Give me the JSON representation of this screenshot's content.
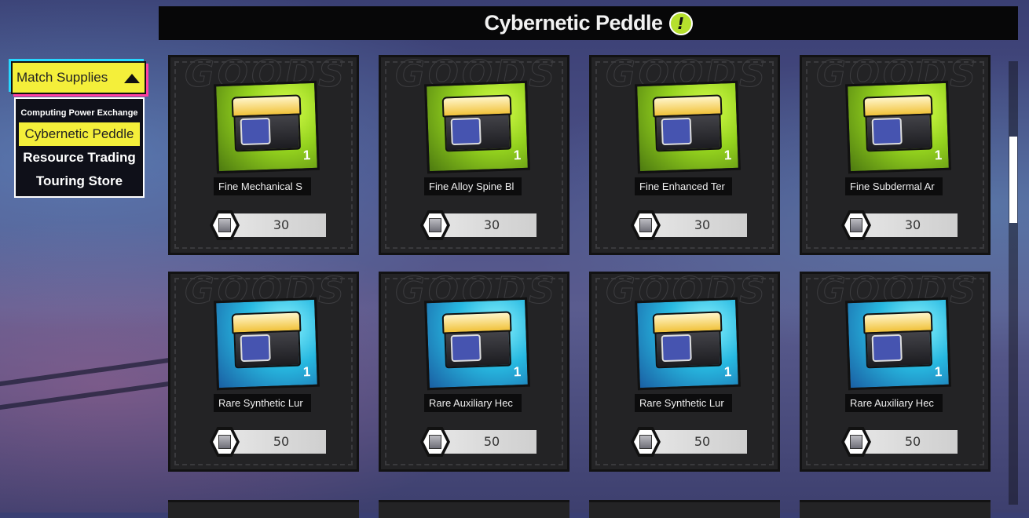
{
  "header": {
    "title": "Cybernetic Peddle",
    "icon": "exclamation-badge-icon",
    "accent": "#b5e02d"
  },
  "menu": {
    "header_label": "Match Supplies",
    "items": [
      {
        "label": "Computing Power Exchange",
        "active": false
      },
      {
        "label": "Cybernetic Peddle",
        "active": true
      },
      {
        "label": "Resource Trading",
        "active": false
      },
      {
        "label": "Touring Store",
        "active": false
      }
    ],
    "accent": "#f4ef3a"
  },
  "goods_watermark": "GOODS",
  "cards": [
    {
      "name": "Fine Mechanical S",
      "quantity": "1",
      "price": "30",
      "rarity_color": "#94d21e"
    },
    {
      "name": "Fine Alloy Spine Bl",
      "quantity": "1",
      "price": "30",
      "rarity_color": "#94d21e"
    },
    {
      "name": "Fine Enhanced Ter",
      "quantity": "1",
      "price": "30",
      "rarity_color": "#94d21e"
    },
    {
      "name": "Fine Subdermal Ar",
      "quantity": "1",
      "price": "30",
      "rarity_color": "#94d21e"
    },
    {
      "name": "Rare Synthetic Lur",
      "quantity": "1",
      "price": "50",
      "rarity_color": "#27b8e0"
    },
    {
      "name": "Rare Auxiliary Hec",
      "quantity": "1",
      "price": "50",
      "rarity_color": "#27b8e0"
    },
    {
      "name": "Rare Synthetic Lur",
      "quantity": "1",
      "price": "50",
      "rarity_color": "#27b8e0"
    },
    {
      "name": "Rare Auxiliary Hec",
      "quantity": "1",
      "price": "50",
      "rarity_color": "#27b8e0"
    }
  ]
}
